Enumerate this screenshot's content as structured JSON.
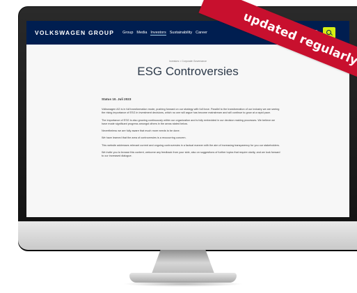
{
  "nav": {
    "brand": "VOLKSWAGEN GROUP",
    "links": [
      "Group",
      "Media",
      "Investors",
      "Sustainability",
      "Career"
    ],
    "active_link": "Investors"
  },
  "breadcrumb": "Investors > Corporate Governance",
  "page_title": "ESG Controversies",
  "status": "Status 10. Juli 2023",
  "paragraphs": [
    "Volkswagen AG is in full transformation mode, pushing forward on our strategy with full force. Parallel to the transformation of our industry we are seeing the rising importance of ESG in investment decisions, which no one will argue has become mainstream and will continue to grow at a rapid pace.",
    "The importance of ESG is also growing continuously within our organization and is fully embedded in our decision making processes. We believe we have made significant progress amongst others in the areas stated below.",
    "Nevertheless we are fully aware that much more needs to be done.",
    "We have learned that the area of controversies is a reoccurring concern.",
    "This website addresses relevant current and ongoing controversies in a factual manner with the aim of increasing transparency for you our stakeholders.",
    "We invite you to browse this content, welcome any feedback from your side, also on suggestions of further topics that require clarity, and we look forward to our increased dialogue."
  ],
  "ribbon": "updated regularly",
  "colors": {
    "nav_bg": "#001e50",
    "search_accent": "#d4ef14",
    "ribbon": "#c8102e",
    "title": "#2d3a4a"
  }
}
